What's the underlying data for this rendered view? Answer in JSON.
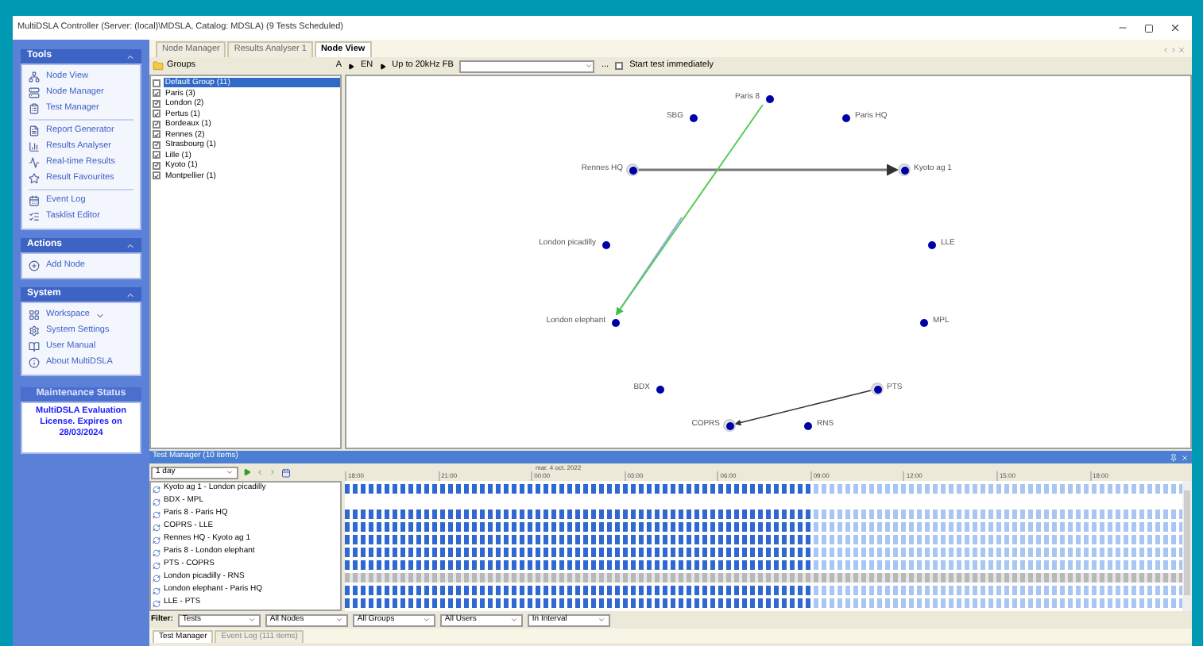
{
  "window": {
    "title": "MultiDSLA Controller (Server: (local)\\MDSLA, Catalog: MDSLA) (9 Tests Scheduled)"
  },
  "sidebar": [
    {
      "title": "Tools",
      "items": [
        "Node View",
        "Node Manager",
        "Test Manager",
        "Report Generator",
        "Results Analyser",
        "Real-time Results",
        "Result Favourites",
        "Event Log",
        "Tasklist Editor"
      ]
    },
    {
      "title": "Actions",
      "items": [
        "Add Node"
      ]
    },
    {
      "title": "System",
      "items": [
        "Workspace",
        "System Settings",
        "User Manual",
        "About MultiDSLA"
      ]
    }
  ],
  "maintenance": {
    "title": "Maintenance Status",
    "text": "MultiDSLA Evaluation License. Expires on 28/03/2024"
  },
  "tabs": [
    {
      "label": "Node Manager",
      "selected": false
    },
    {
      "label": "Results Analyser 1",
      "selected": false
    },
    {
      "label": "Node View",
      "selected": true
    }
  ],
  "groups": {
    "title": "Groups",
    "sort": "A",
    "items": [
      {
        "label": "Default Group (11)",
        "checked": false,
        "selected": true
      },
      {
        "label": "Paris (3)",
        "checked": true,
        "selected": false
      },
      {
        "label": "London (2)",
        "checked": true,
        "selected": false
      },
      {
        "label": "Pertus (1)",
        "checked": true,
        "selected": false
      },
      {
        "label": "Bordeaux (1)",
        "checked": true,
        "selected": false
      },
      {
        "label": "Rennes (2)",
        "checked": true,
        "selected": false
      },
      {
        "label": "Strasbourg (1)",
        "checked": true,
        "selected": false
      },
      {
        "label": "Lille (1)",
        "checked": true,
        "selected": false
      },
      {
        "label": "Kyoto (1)",
        "checked": true,
        "selected": false
      },
      {
        "label": "Montpellier (1)",
        "checked": true,
        "selected": false
      }
    ]
  },
  "toolbar": {
    "language": "EN",
    "bandwidth": "Up to 20kHz FB",
    "more": "...",
    "start_immediately": {
      "label": "Start test immediately",
      "checked": false
    }
  },
  "nodes": [
    {
      "name": "Paris 8",
      "active": false
    },
    {
      "name": "SBG",
      "active": false
    },
    {
      "name": "Paris HQ",
      "active": false
    },
    {
      "name": "Rennes HQ",
      "active": true
    },
    {
      "name": "Kyoto ag 1",
      "active": true
    },
    {
      "name": "London picadilly",
      "active": false
    },
    {
      "name": "LLE",
      "active": false
    },
    {
      "name": "London elephant",
      "active": false
    },
    {
      "name": "MPL",
      "active": false
    },
    {
      "name": "BDX",
      "active": false
    },
    {
      "name": "PTS",
      "active": true
    },
    {
      "name": "COPRS",
      "active": true
    },
    {
      "name": "RNS",
      "active": false
    }
  ],
  "test_manager": {
    "title": "Test Manager (10 items)",
    "range": "1 day",
    "date": "mar. 4 oct. 2022",
    "hours": [
      "18:00",
      "21:00",
      "00:00",
      "03:00",
      "06:00",
      "09:00",
      "12:00",
      "15:00",
      "18:00"
    ],
    "tests": [
      {
        "name": "Kyoto ag 1 - London picadilly",
        "kind": "active"
      },
      {
        "name": "BDX - MPL",
        "kind": "none"
      },
      {
        "name": "Paris 8 - Paris HQ",
        "kind": "active"
      },
      {
        "name": "COPRS - LLE",
        "kind": "active"
      },
      {
        "name": "Rennes HQ - Kyoto ag 1",
        "kind": "active"
      },
      {
        "name": "Paris 8 - London elephant",
        "kind": "active"
      },
      {
        "name": "PTS - COPRS",
        "kind": "active"
      },
      {
        "name": "London picadilly - RNS",
        "kind": "disabled"
      },
      {
        "name": "London elephant - Paris HQ",
        "kind": "active"
      },
      {
        "name": "LLE - PTS",
        "kind": "active"
      }
    ],
    "filter_label": "Filter:",
    "filters": [
      "Tests",
      "All Nodes",
      "All Groups",
      "All Users",
      "In Interval"
    ]
  },
  "bottom_tabs": [
    {
      "label": "Test Manager",
      "selected": true
    },
    {
      "label": "Event Log (111 items)",
      "selected": false
    }
  ]
}
